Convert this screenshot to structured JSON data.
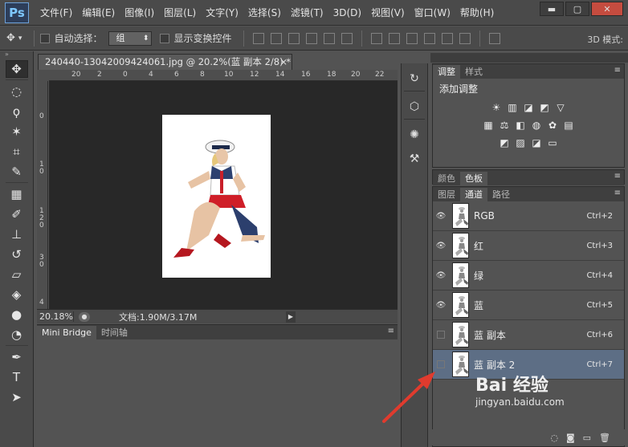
{
  "app": {
    "logo": "Ps",
    "menu": [
      "文件(F)",
      "编辑(E)",
      "图像(I)",
      "图层(L)",
      "文字(Y)",
      "选择(S)",
      "滤镜(T)",
      "3D(D)",
      "视图(V)",
      "窗口(W)",
      "帮助(H)"
    ],
    "window_controls": [
      "▬",
      "▢",
      "✕"
    ]
  },
  "options": {
    "auto_select_label": "自动选择：",
    "group_value": "组",
    "show_transform_label": "显示变换控件",
    "mode3d_label": "3D 模式:"
  },
  "document": {
    "tab_title": "240440-13042009424061.jpg @ 20.2%(蓝 副本 2/8) *",
    "tab_close": "×",
    "ruler_h": [
      "20",
      "2",
      "0",
      "4",
      "6",
      "8",
      "10",
      "12",
      "14",
      "16",
      "18",
      "20",
      "22",
      "24"
    ],
    "ruler_v": [
      "0",
      "1 0",
      "1 2 0",
      "3 0",
      "4"
    ],
    "zoom": "20.18%",
    "doc_info": "文档:1.90M/3.17M"
  },
  "bottom_panel": {
    "tabs": [
      "Mini Bridge",
      "时间轴"
    ]
  },
  "adjust_panel": {
    "tabs": [
      "调整",
      "样式"
    ],
    "title": "添加调整",
    "icons_row1": [
      "☀",
      "▥",
      "◪",
      "◩",
      "▽"
    ],
    "icons_row2": [
      "▦",
      "⚖",
      "◧",
      "◍",
      "✿",
      "▤"
    ],
    "icons_row3": [
      "◩",
      "▨",
      "◪",
      "▭"
    ]
  },
  "color_panel": {
    "tabs": [
      "颜色",
      "色板"
    ]
  },
  "channels_panel": {
    "tabs": [
      "图层",
      "通道",
      "路径"
    ],
    "channels": [
      {
        "name": "RGB",
        "shortcut": "Ctrl+2",
        "visible": true,
        "selected": false
      },
      {
        "name": "红",
        "shortcut": "Ctrl+3",
        "visible": true,
        "selected": false
      },
      {
        "name": "绿",
        "shortcut": "Ctrl+4",
        "visible": true,
        "selected": false
      },
      {
        "name": "蓝",
        "shortcut": "Ctrl+5",
        "visible": true,
        "selected": false
      },
      {
        "name": "蓝 副本",
        "shortcut": "Ctrl+6",
        "visible": false,
        "selected": false
      },
      {
        "name": "蓝 副本 2",
        "shortcut": "Ctrl+7",
        "visible": false,
        "selected": true
      }
    ]
  },
  "watermark": {
    "brand": "Bai 经验",
    "url": "jingyan.baidu.com"
  },
  "colors": {
    "selected_row": "#5d6e85",
    "arrow": "#e03b2e"
  }
}
